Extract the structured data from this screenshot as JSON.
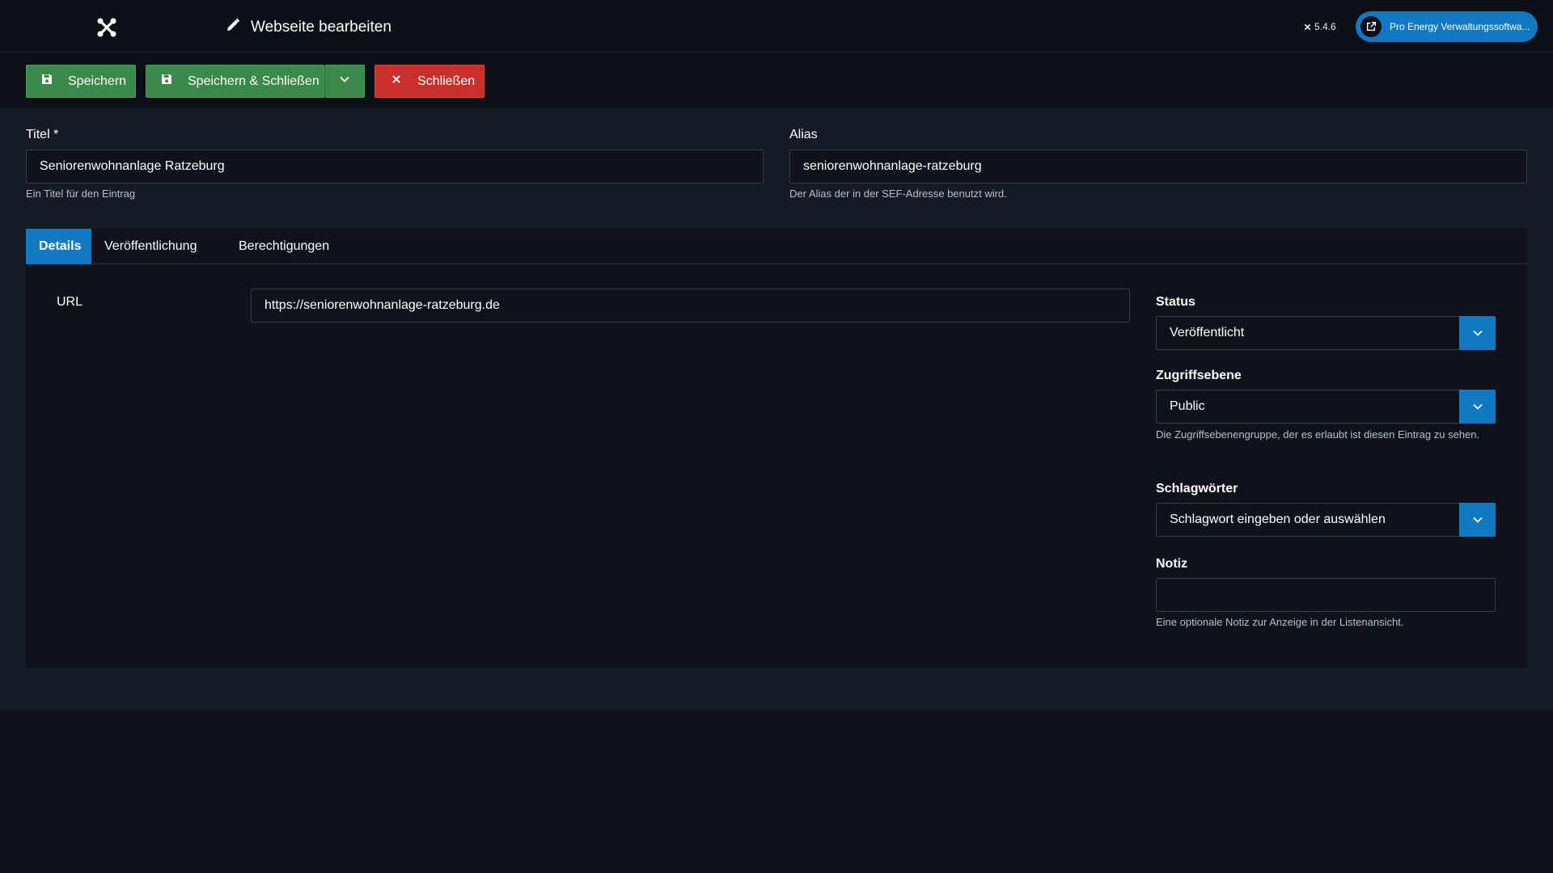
{
  "header": {
    "title": "Webseite bearbeiten",
    "version": "5.4.6",
    "site_link": "Pro Energy Verwaltungssoftwa..."
  },
  "toolbar": {
    "save_label": "Speichern",
    "save_close_label": "Speichern & Schließen",
    "close_label": "Schließen"
  },
  "form": {
    "title_label": "Titel *",
    "title_value": "Seniorenwohnanlage Ratzeburg",
    "title_help": "Ein Titel für den Eintrag",
    "alias_label": "Alias",
    "alias_value": "seniorenwohnanlage-ratzeburg",
    "alias_help": "Der Alias der in der SEF-Adresse benutzt wird."
  },
  "tabs": [
    {
      "label": "Details",
      "active": true
    },
    {
      "label": "Veröffentlichung",
      "active": false
    },
    {
      "label": "Berechtigungen",
      "active": false
    }
  ],
  "details": {
    "url_label": "URL",
    "url_value": "https://seniorenwohnanlage-ratzeburg.de",
    "status_label": "Status",
    "status_value": "Veröffentlicht",
    "access_label": "Zugriffsebene",
    "access_value": "Public",
    "access_help": "Die Zugriffsebenengruppe, der es erlaubt ist diesen Eintrag zu sehen.",
    "tags_label": "Schlagwörter",
    "tags_placeholder": "Schlagwort eingeben oder auswählen",
    "note_label": "Notiz",
    "note_value": "",
    "note_help": "Eine optionale Notiz zur Anzeige in der Listenansicht."
  },
  "colors": {
    "accent": "#1179c4",
    "success": "#3b8a4a",
    "danger": "#c9302c",
    "background": "#0e131b"
  },
  "icons": {
    "logo": "joomla-logo-icon",
    "edit": "pencil-icon",
    "external": "external-link-icon",
    "save": "floppy-disk-icon",
    "close": "x-icon",
    "dropdown": "chevron-down-icon"
  }
}
